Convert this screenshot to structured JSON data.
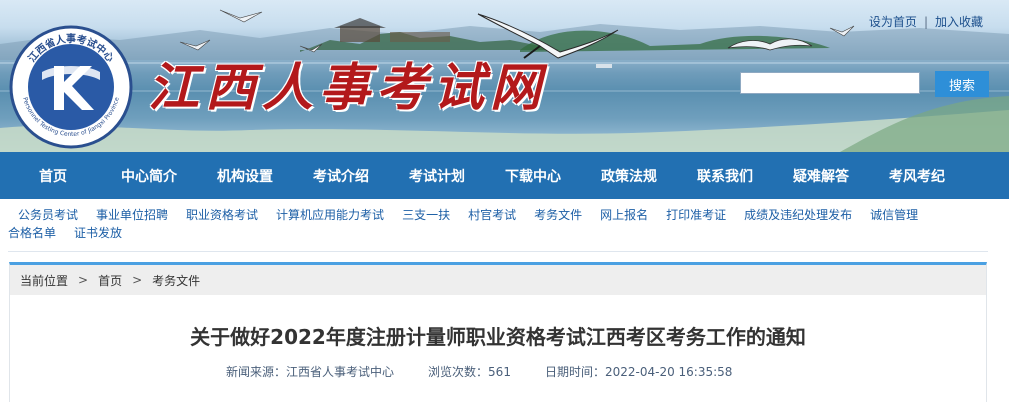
{
  "header": {
    "site_title": "江西人事考试网",
    "logo_text_top": "江西省人事考试中心",
    "logo_text_bottom": "Personnel Testing Center of Jiangxi Province",
    "top_links": [
      "设为首页",
      "加入收藏"
    ],
    "top_links_separator": "|",
    "search_placeholder": "",
    "search_button": "搜索"
  },
  "main_nav": [
    "首页",
    "中心简介",
    "机构设置",
    "考试介绍",
    "考试计划",
    "下载中心",
    "政策法规",
    "联系我们",
    "疑难解答",
    "考风考纪"
  ],
  "sub_nav": [
    "公务员考试",
    "事业单位招聘",
    "职业资格考试",
    "计算机应用能力考试",
    "三支一扶",
    "村官考试",
    "考务文件",
    "网上报名",
    "打印准考证",
    "成绩及违纪处理发布",
    "诚信管理",
    "合格名单",
    "证书发放"
  ],
  "breadcrumb": {
    "label": "当前位置",
    "separator": ">",
    "items": [
      "首页",
      "考务文件"
    ]
  },
  "article": {
    "title": "关于做好2022年度注册计量师职业资格考试江西考区考务工作的通知",
    "source_label": "新闻来源：",
    "source_value": "江西省人事考试中心",
    "views_label": "浏览次数：",
    "views_value": "561",
    "date_label": "日期时间：",
    "date_value": "2022-04-20 16:35:58"
  },
  "colors": {
    "nav_bg": "#2270b2",
    "title_red": "#b3191b",
    "accent_blue": "#4aa0e2",
    "link_blue": "#1d5fa6"
  }
}
